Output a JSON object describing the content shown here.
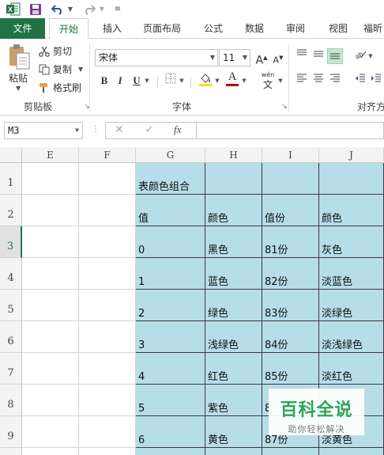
{
  "ribbon_tabs": [
    "文件",
    "开始",
    "插入",
    "页面布局",
    "公式",
    "数据",
    "审阅",
    "视图",
    "福昕"
  ],
  "clipboard": {
    "paste": "粘贴",
    "cut": "剪切",
    "copy": "复制",
    "format_painter": "格式刷",
    "group_label": "剪贴板"
  },
  "font": {
    "name": "宋体",
    "size": "11",
    "group_label": "字体",
    "bold": "B",
    "italic": "I",
    "underline": "U",
    "font_color_glyph": "A",
    "grow_glyph": "A",
    "shrink_glyph": "A",
    "wen_top": "wén",
    "wen_bottom": "文"
  },
  "alignment": {
    "group_label": "对齐方"
  },
  "formula_bar": {
    "name_box": "M3",
    "fx": "fx",
    "formula": ""
  },
  "columns": [
    "E",
    "F",
    "G",
    "H",
    "I",
    "J"
  ],
  "rows": [
    "1",
    "2",
    "3",
    "4",
    "5",
    "6",
    "7",
    "8",
    "9"
  ],
  "selected_row": "3",
  "table": [
    [
      "表颜色组合",
      "",
      "",
      ""
    ],
    [
      "值",
      "颜色",
      "值份",
      "颜色"
    ],
    [
      "0",
      "黑色",
      "81份",
      "灰色"
    ],
    [
      "1",
      "蓝色",
      "82份",
      "淡蓝色"
    ],
    [
      "2",
      "绿色",
      "83份",
      "淡绿色"
    ],
    [
      "3",
      "浅绿色",
      "84份",
      "淡浅绿色"
    ],
    [
      "4",
      "红色",
      "85份",
      "淡红色"
    ],
    [
      "5",
      "紫色",
      "8",
      ""
    ],
    [
      "6",
      "黄色",
      "87份",
      "淡黄色"
    ]
  ],
  "watermark": {
    "title": "百科全说",
    "subtitle": "助你轻松解决"
  },
  "colors": {
    "accent_green": "#217346",
    "cell_fill": "#b7dde8",
    "watermark_green": "#2ba55a",
    "font_color_bar": "#c00000"
  }
}
